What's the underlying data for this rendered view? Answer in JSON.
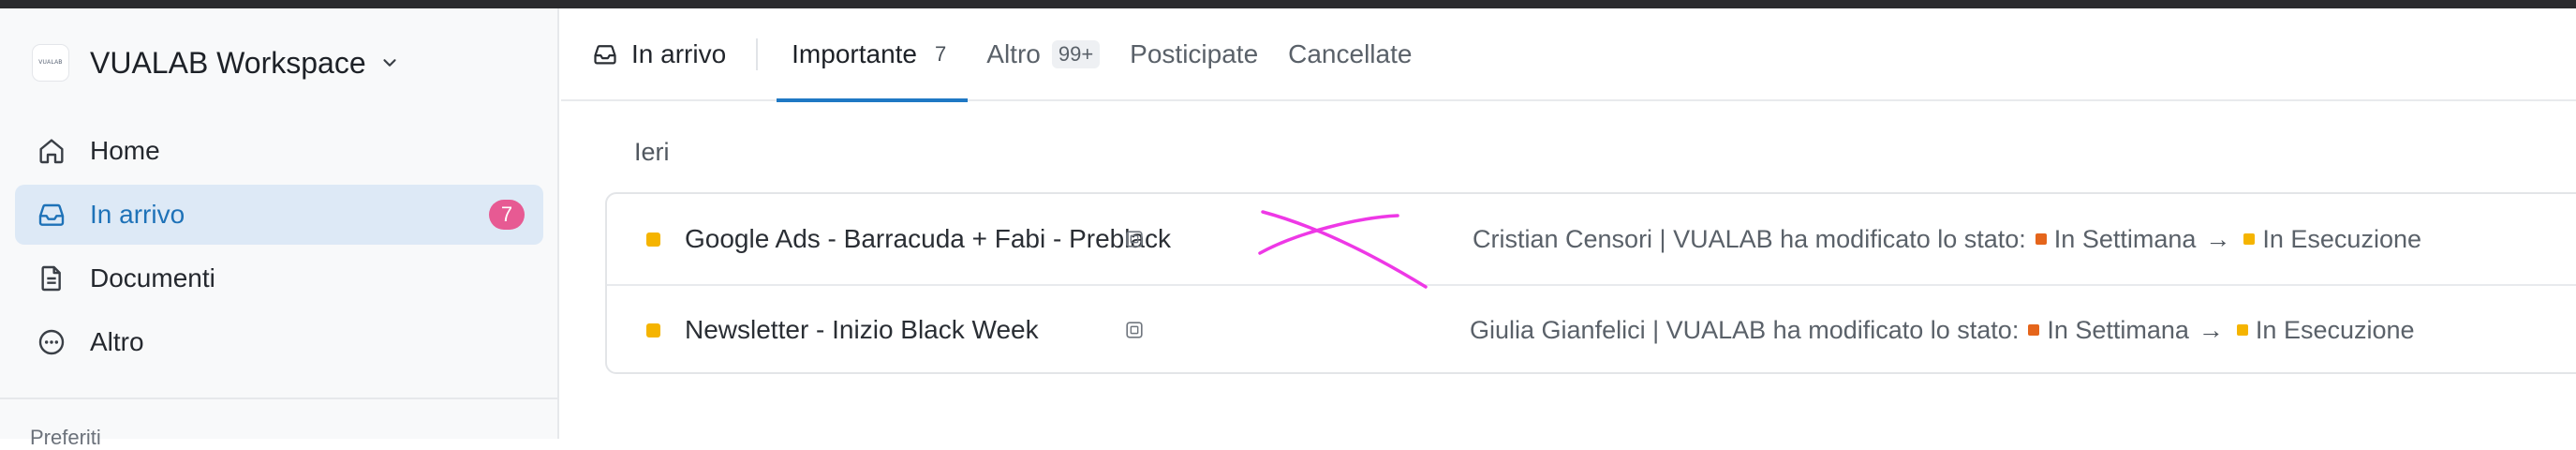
{
  "sidebar": {
    "workspace": {
      "logo_text": "VUALAB",
      "name": "VUALAB Workspace"
    },
    "items": [
      {
        "label": "Home",
        "icon": "home-icon"
      },
      {
        "label": "In arrivo",
        "icon": "inbox-icon",
        "badge": "7",
        "active": true
      },
      {
        "label": "Documenti",
        "icon": "document-icon"
      },
      {
        "label": "Altro",
        "icon": "more-icon"
      }
    ],
    "section_label": "Preferiti"
  },
  "tabs": {
    "inbox_label": "In arrivo",
    "items": [
      {
        "label": "Importante",
        "count": "7",
        "active": true
      },
      {
        "label": "Altro",
        "count": "99+"
      },
      {
        "label": "Posticipate"
      },
      {
        "label": "Cancellate"
      }
    ]
  },
  "main": {
    "group_label": "Ieri",
    "rows": [
      {
        "title": "Google Ads - Barracuda + Fabi - Preblack",
        "actor": "Cristian Censori | VUALAB",
        "action": "ha modificato lo stato:",
        "from_status": "In Settimana",
        "to_status": "In Esecuzione"
      },
      {
        "title": "Newsletter - Inizio Black Week",
        "actor": "Giulia Gianfelici | VUALAB",
        "action": "ha modificato lo stato:",
        "from_status": "In Settimana",
        "to_status": "In Esecuzione"
      }
    ],
    "arrow": "→"
  },
  "colors": {
    "accent": "#1f78c4",
    "badge": "#e75a93",
    "status_in_settimana": "#e5651b",
    "status_in_esecuzione": "#f5b400",
    "row_dot": "#f5b400",
    "annotation": "#ee38e6"
  }
}
